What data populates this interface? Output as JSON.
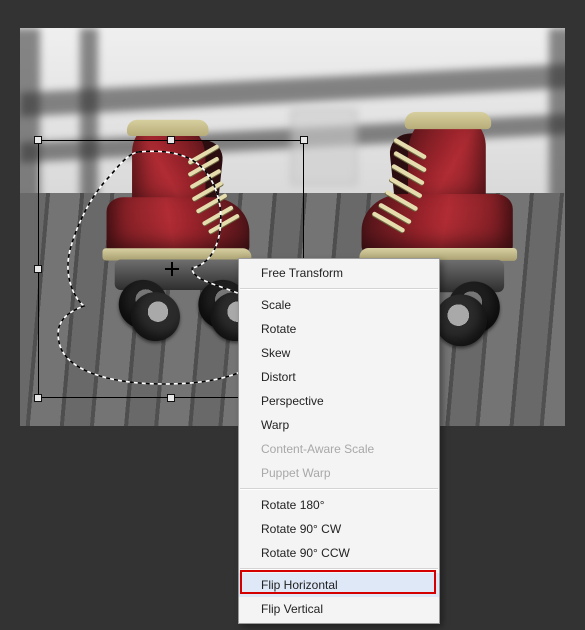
{
  "context_menu": {
    "group1": {
      "free_transform": "Free Transform"
    },
    "group2": {
      "scale": "Scale",
      "rotate": "Rotate",
      "skew": "Skew",
      "distort": "Distort",
      "perspective": "Perspective",
      "warp": "Warp",
      "content_aware_scale": "Content-Aware Scale",
      "puppet_warp": "Puppet Warp"
    },
    "group3": {
      "rotate_180": "Rotate 180°",
      "rotate_90_cw": "Rotate 90° CW",
      "rotate_90_ccw": "Rotate 90° CCW"
    },
    "group4": {
      "flip_horizontal": "Flip Horizontal",
      "flip_vertical": "Flip Vertical"
    }
  },
  "menu_state": {
    "hovered": "flip_horizontal",
    "disabled": [
      "content_aware_scale",
      "puppet_warp"
    ]
  }
}
